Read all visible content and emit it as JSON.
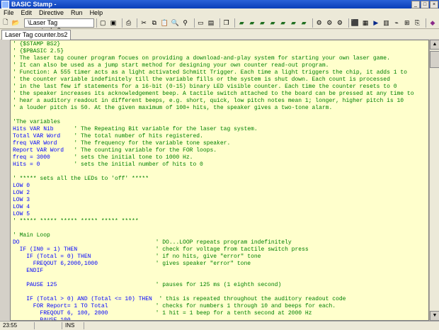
{
  "window": {
    "title": "BASIC Stamp - ",
    "icon": "stamp-icon"
  },
  "menu": [
    "File",
    "Edit",
    "Directive",
    "Run",
    "Help"
  ],
  "toolbar": {
    "file_path": "\\Laser Tag counter.bs2"
  },
  "tabs": [
    {
      "label": "Laser Tag counter.bs2"
    }
  ],
  "code_lines": [
    {
      "text": "' {$STAMP BS2}",
      "style": "cmt"
    },
    {
      "text": "' {$PBASIC 2.5}",
      "style": "cmt"
    },
    {
      "text": "' The laser tag couner program focues on providing a download-and-play system for starting your own laser game.",
      "style": "cmt"
    },
    {
      "text": "' It can also be used as a jump start method for designing your own counter read-out program.",
      "style": "cmt"
    },
    {
      "text": "' Function: A 555 timer acts as a light activated Schmitt Trigger. Each time a light triggers the chip, it adds 1 to",
      "style": "cmt"
    },
    {
      "text": "' the counter variable indefinitely till the variable fills or the system is shut down. Each count is processed",
      "style": "cmt"
    },
    {
      "text": "' in the last few if statements for a 16-bit (0-15) binary LED visible counter. Each time the counter resets to 0",
      "style": "cmt"
    },
    {
      "text": "' the speaker increases its acknowledgement beep. A tactile switch attached to the board can be pressed at any time to",
      "style": "cmt"
    },
    {
      "text": "' hear a auditory readout in different beeps, e.g. short, quick, low pitch notes mean 1; longer, higher pitch is 10",
      "style": "cmt"
    },
    {
      "text": "' a louder pitch is 50. At the given maximum of 100+ hits, the speaker gives a two-tone alarm.",
      "style": "cmt"
    },
    {
      "text": "",
      "style": ""
    },
    {
      "text": "'The variables",
      "style": "cmt"
    },
    {
      "text": "Hits VAR Nib      ' The Repeating Bit variable for the laser tag system.",
      "style": "mix"
    },
    {
      "text": "Total VAR Word    ' The total number of hits registered.",
      "style": "mix"
    },
    {
      "text": "freq VAR Word     ' The frequency for the variable tone speaker.",
      "style": "mix"
    },
    {
      "text": "Report VAR Word   ' The counting variable for the FOR loops.",
      "style": "mix"
    },
    {
      "text": "freq = 3000       ' sets the initial tone to 1000 Hz.",
      "style": "mix"
    },
    {
      "text": "Hits = 0          ' sets the initial number of hits to 0",
      "style": "mix"
    },
    {
      "text": "",
      "style": ""
    },
    {
      "text": "' ***** sets all the LEDs to 'off' *****",
      "style": "cmt"
    },
    {
      "text": "LOW 0",
      "style": "kw"
    },
    {
      "text": "LOW 2",
      "style": "kw"
    },
    {
      "text": "LOW 3",
      "style": "kw"
    },
    {
      "text": "LOW 4",
      "style": "kw"
    },
    {
      "text": "LOW 5",
      "style": "kw"
    },
    {
      "text": "' ***** ***** ***** ***** ***** *****",
      "style": "cmt"
    },
    {
      "text": "",
      "style": ""
    },
    {
      "text": "' Main Loop",
      "style": "cmt"
    },
    {
      "text": "DO                                        ' DO...LOOP repeats program indefinitely",
      "style": "mix"
    },
    {
      "text": "  IF (IN0 = 1) THEN                       ' check for voltage from tactile switch press",
      "style": "mix"
    },
    {
      "text": "    IF (Total = 0) THEN                   ' if no hits, give \"error\" tone",
      "style": "mix"
    },
    {
      "text": "      FREQOUT 6,2000,1000                 ' gives speaker \"error\" tone",
      "style": "mix"
    },
    {
      "text": "    ENDIF",
      "style": "kw"
    },
    {
      "text": "",
      "style": ""
    },
    {
      "text": "    PAUSE 125                             ' pauses for 125 ms (1 eighth second)",
      "style": "mix"
    },
    {
      "text": "",
      "style": ""
    },
    {
      "text": "    IF (Total > 0) AND (Total <= 10) THEN  ' this is repeated throughout the auditory readout code",
      "style": "mix"
    },
    {
      "text": "      FOR Report= 1 TO Total              ' checks for numbers 1 through 10 and beeps for each.",
      "style": "mix"
    },
    {
      "text": "        FREQOUT 6, 100, 2000              ' 1 hit = 1 beep for a tenth second at 2000 Hz",
      "style": "mix"
    },
    {
      "text": "        PAUSE 100",
      "style": "kw"
    }
  ],
  "status": {
    "position": "23:55",
    "mode": "INS"
  }
}
